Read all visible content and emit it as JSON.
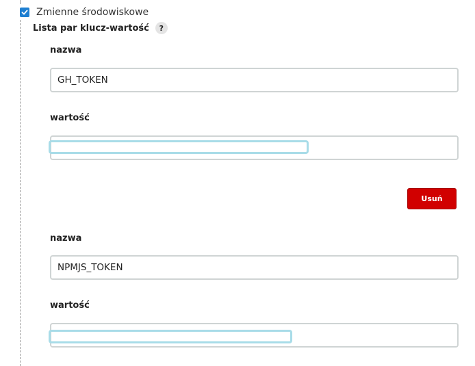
{
  "env_section": {
    "checkbox_label": "Zmienne środowiskowe",
    "checked": true,
    "list_title": "Lista par klucz-wartość",
    "help_glyph": "?",
    "help_icon": "question-mark-icon",
    "check_icon": "checkmark-icon"
  },
  "pairs": [
    {
      "name_label": "nazwa",
      "name_value": "GH_TOKEN",
      "value_label": "wartość",
      "value_value": "",
      "value_redacted": true
    },
    {
      "name_label": "nazwa",
      "name_value": "NPMJS_TOKEN",
      "value_label": "wartość",
      "value_value": "",
      "value_redacted": true
    }
  ],
  "delete_button": {
    "label": "Usuń",
    "color": "#d10000"
  },
  "colors": {
    "checkbox": "#1f7fd1",
    "input_border": "#cfd4d4",
    "redaction_outline": "#a8dce8"
  }
}
